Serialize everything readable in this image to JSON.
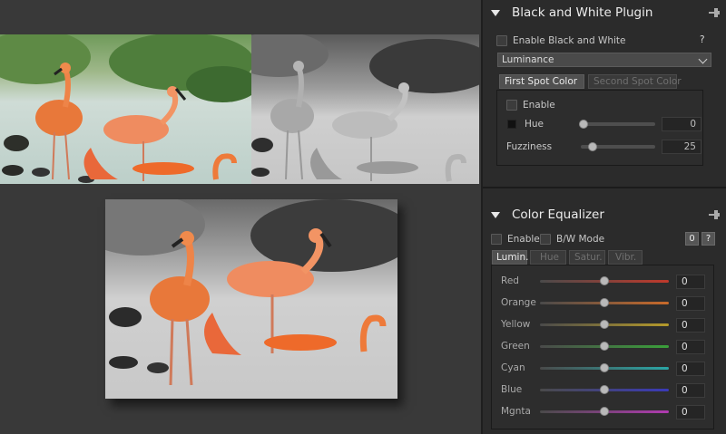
{
  "bw_plugin": {
    "title": "Black and White Plugin",
    "enable_label": "Enable Black and White",
    "help": "?",
    "mode": "Luminance",
    "tabs": [
      "First Spot Color",
      "Second Spot Color"
    ],
    "spot": {
      "enable_label": "Enable",
      "hue_label": "Hue",
      "hue_value": "0",
      "hue_level": 0,
      "fuzziness_label": "Fuzziness",
      "fuzziness_value": "25",
      "fuzziness_level": 0.12
    }
  },
  "equalizer": {
    "title": "Color Equalizer",
    "enable_label": "Enable",
    "bw_mode_label": "B/W Mode",
    "zero_btn": "0",
    "help": "?",
    "tabs": [
      "Lumin.",
      "Hue",
      "Satur.",
      "Vibr."
    ],
    "channels": [
      {
        "name": "Red",
        "value": "0",
        "level": 0.5,
        "color": "#c0392b"
      },
      {
        "name": "Orange",
        "value": "0",
        "level": 0.5,
        "color": "#c86a2a"
      },
      {
        "name": "Yellow",
        "value": "0",
        "level": 0.5,
        "color": "#b59a2a"
      },
      {
        "name": "Green",
        "value": "0",
        "level": 0.5,
        "color": "#3aa03a"
      },
      {
        "name": "Cyan",
        "value": "0",
        "level": 0.5,
        "color": "#2aa6a6"
      },
      {
        "name": "Blue",
        "value": "0",
        "level": 0.5,
        "color": "#3a3ab8"
      },
      {
        "name": "Mgnta",
        "value": "0",
        "level": 0.5,
        "color": "#b03ab0"
      }
    ]
  }
}
